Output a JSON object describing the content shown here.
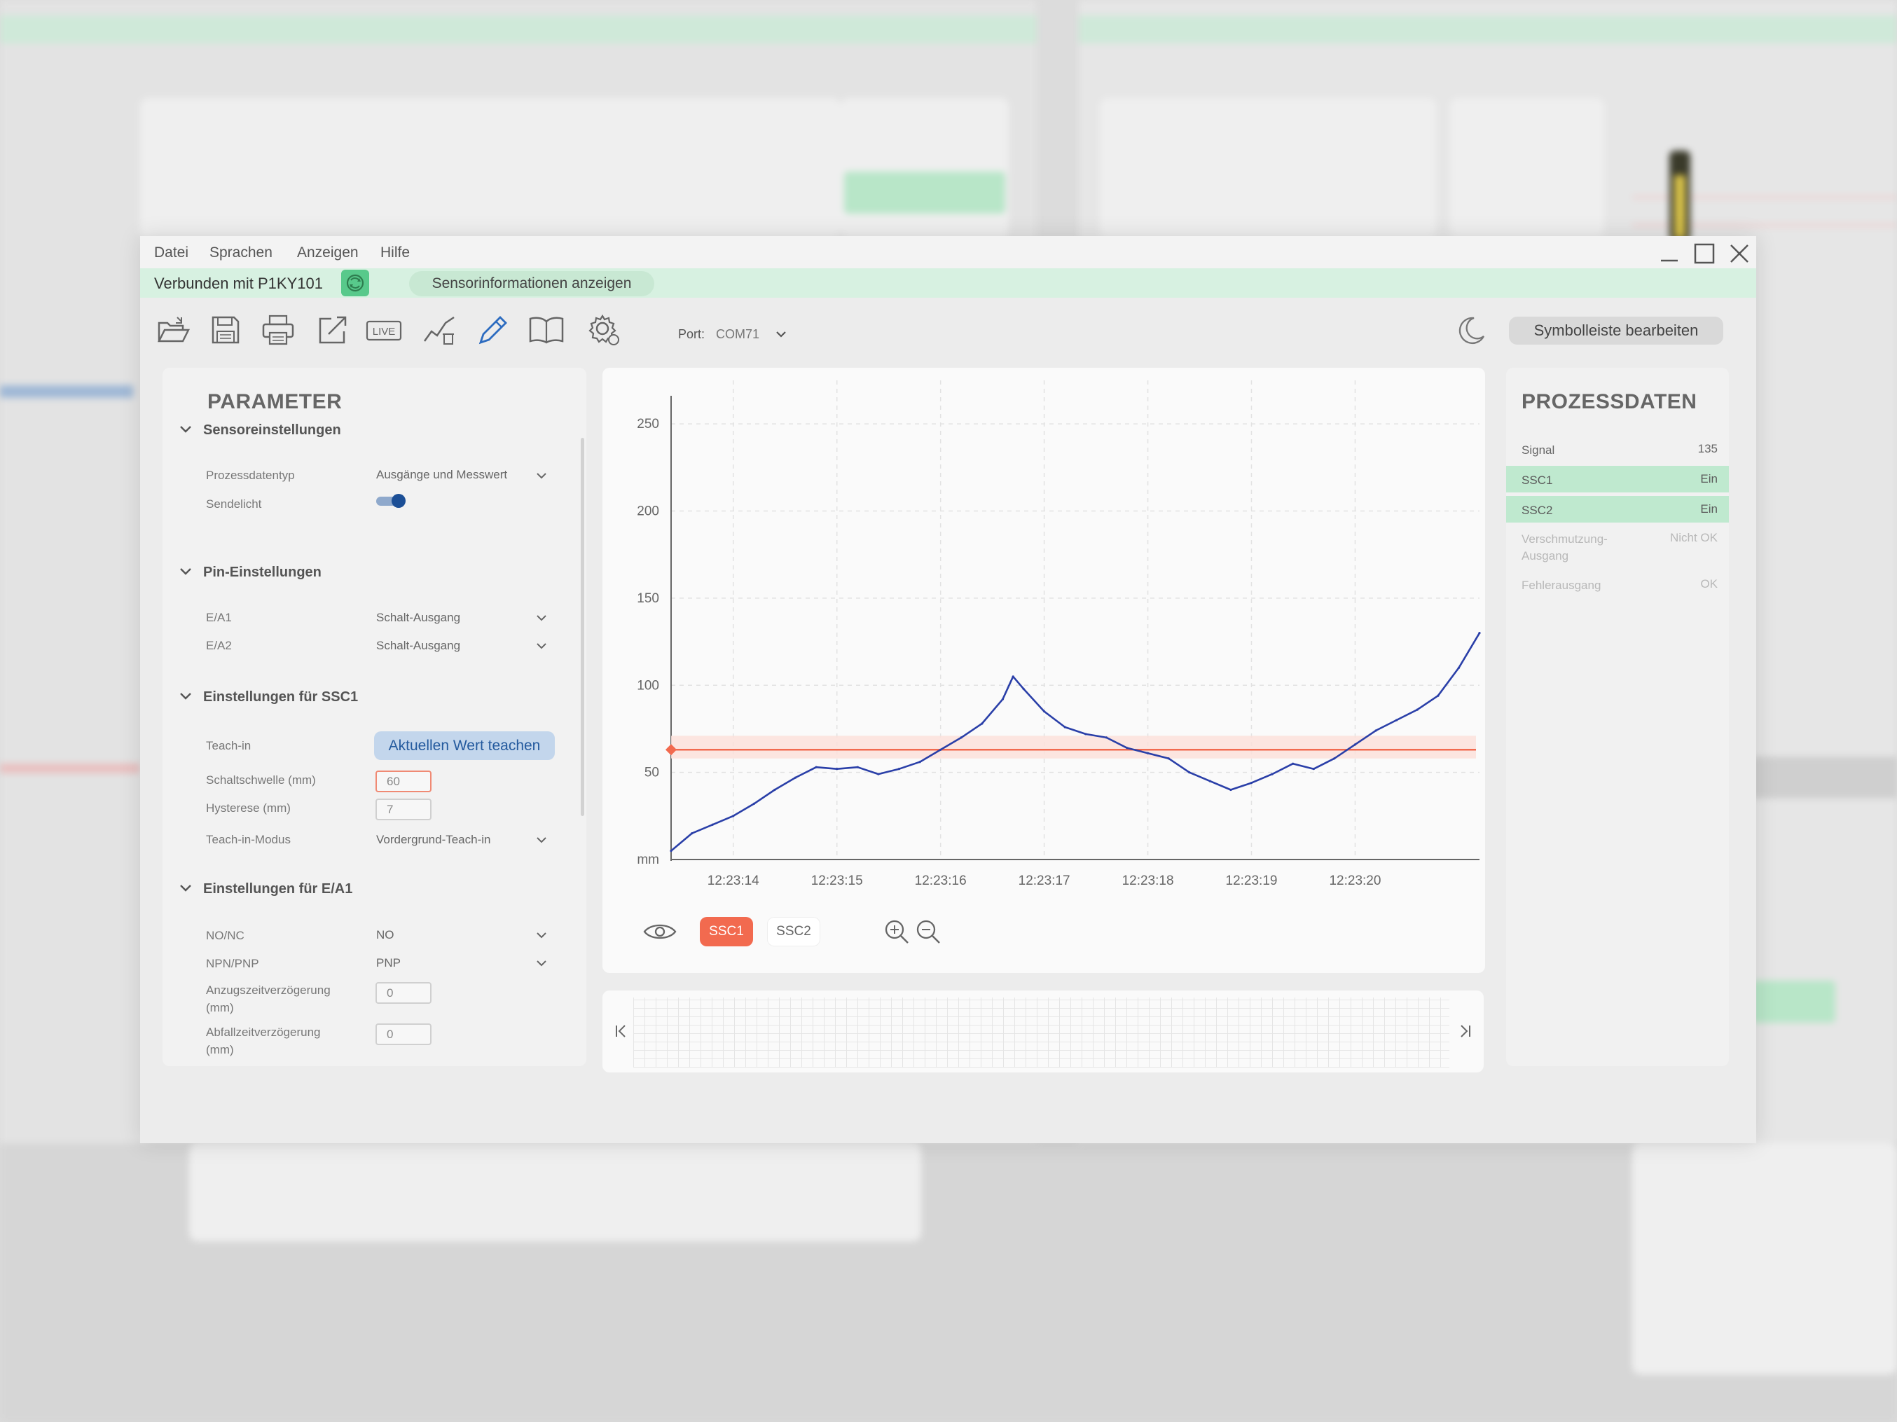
{
  "menu": [
    "Datei",
    "Sprachen",
    "Anzeigen",
    "Hilfe"
  ],
  "status": {
    "connected_text": "Verbunden mit P1KY101",
    "sensor_info_button": "Sensorinformationen anzeigen",
    "color": "#d7f1e1"
  },
  "toolbar": {
    "icons": [
      "open-folder-icon",
      "save-icon",
      "print-icon",
      "export-icon",
      "live-icon",
      "chart-delete-icon",
      "pencil-icon",
      "book-icon",
      "settings-gear-icon"
    ],
    "live_label": "LIVE",
    "port_label": "Port:",
    "port_value": "COM71",
    "edit_toolbar_button": "Symbolleiste bearbeiten"
  },
  "parameter": {
    "title": "PARAMETER",
    "sections": {
      "sensor": {
        "heading": "Sensoreinstellungen",
        "prozessdatentyp_label": "Prozessdatentyp",
        "prozessdatentyp_value": "Ausgänge und Messwert",
        "sendelicht_label": "Sendelicht",
        "sendelicht_on": true
      },
      "pin": {
        "heading": "Pin-Einstellungen",
        "ea1_label": "E/A1",
        "ea1_value": "Schalt-Ausgang",
        "ea2_label": "E/A2",
        "ea2_value": "Schalt-Ausgang"
      },
      "ssc1": {
        "heading": "Einstellungen für SSC1",
        "teach_label": "Teach-in",
        "teach_button": "Aktuellen Wert teachen",
        "schaltschwelle_label": "Schaltschwelle (mm)",
        "schaltschwelle_value": "60",
        "hysterese_label": "Hysterese (mm)",
        "hysterese_value": "7",
        "teach_mode_label": "Teach-in-Modus",
        "teach_mode_value": "Vordergrund-Teach-in"
      },
      "ea1": {
        "heading": "Einstellungen für E/A1",
        "nonc_label": "NO/NC",
        "nonc_value": "NO",
        "npnpnp_label": "NPN/PNP",
        "npnpnp_value": "PNP",
        "anzug_label": "Anzugszeitverzögerung (mm)",
        "anzug_value": "0",
        "abfall_label": "Abfallzeitverzögerung (mm)",
        "abfall_value": "0"
      }
    }
  },
  "chart_data": {
    "type": "line",
    "title": "",
    "xlabel": "",
    "ylabel": "mm",
    "ylim": [
      0,
      275
    ],
    "yticks": [
      50,
      100,
      150,
      200,
      250
    ],
    "xticks": [
      "12:23:14",
      "12:23:15",
      "12:23:16",
      "12:23:17",
      "12:23:18",
      "12:23:19",
      "12:23:20"
    ],
    "x": [
      13.4,
      13.6,
      13.8,
      14.0,
      14.2,
      14.4,
      14.6,
      14.8,
      15.0,
      15.2,
      15.4,
      15.6,
      15.8,
      16.0,
      16.2,
      16.4,
      16.6,
      16.7,
      16.8,
      17.0,
      17.2,
      17.4,
      17.6,
      17.8,
      18.0,
      18.2,
      18.4,
      18.6,
      18.8,
      19.0,
      19.2,
      19.4,
      19.6,
      19.8,
      20.0,
      20.2,
      20.4,
      20.6,
      20.8,
      21.0,
      21.2
    ],
    "series": [
      {
        "values": [
          5,
          15,
          20,
          25,
          32,
          40,
          47,
          53,
          52,
          53,
          49,
          52,
          56,
          63,
          70,
          78,
          92,
          105,
          98,
          85,
          76,
          72,
          70,
          64,
          61,
          58,
          50,
          45,
          40,
          44,
          49,
          55,
          52,
          58,
          66,
          74,
          80,
          86,
          94,
          110,
          130
        ],
        "color": "#2a3fa8"
      }
    ],
    "threshold": {
      "value": 63,
      "band": [
        58,
        71
      ],
      "color": "#f26a4f"
    },
    "legend_buttons": [
      "SSC1",
      "SSC2"
    ]
  },
  "process": {
    "title": "PROZESSDATEN",
    "rows": [
      {
        "label": "Signal",
        "value": "135",
        "highlight": false,
        "muted": false
      },
      {
        "label": "SSC1",
        "value": "Ein",
        "highlight": true,
        "muted": false
      },
      {
        "label": "SSC2",
        "value": "Ein",
        "highlight": true,
        "muted": false
      },
      {
        "label": "Verschmutzung-\nAusgang",
        "value": "Nicht OK",
        "highlight": false,
        "muted": true
      },
      {
        "label": "Fehlerausgang",
        "value": "OK",
        "highlight": false,
        "muted": true
      }
    ]
  }
}
